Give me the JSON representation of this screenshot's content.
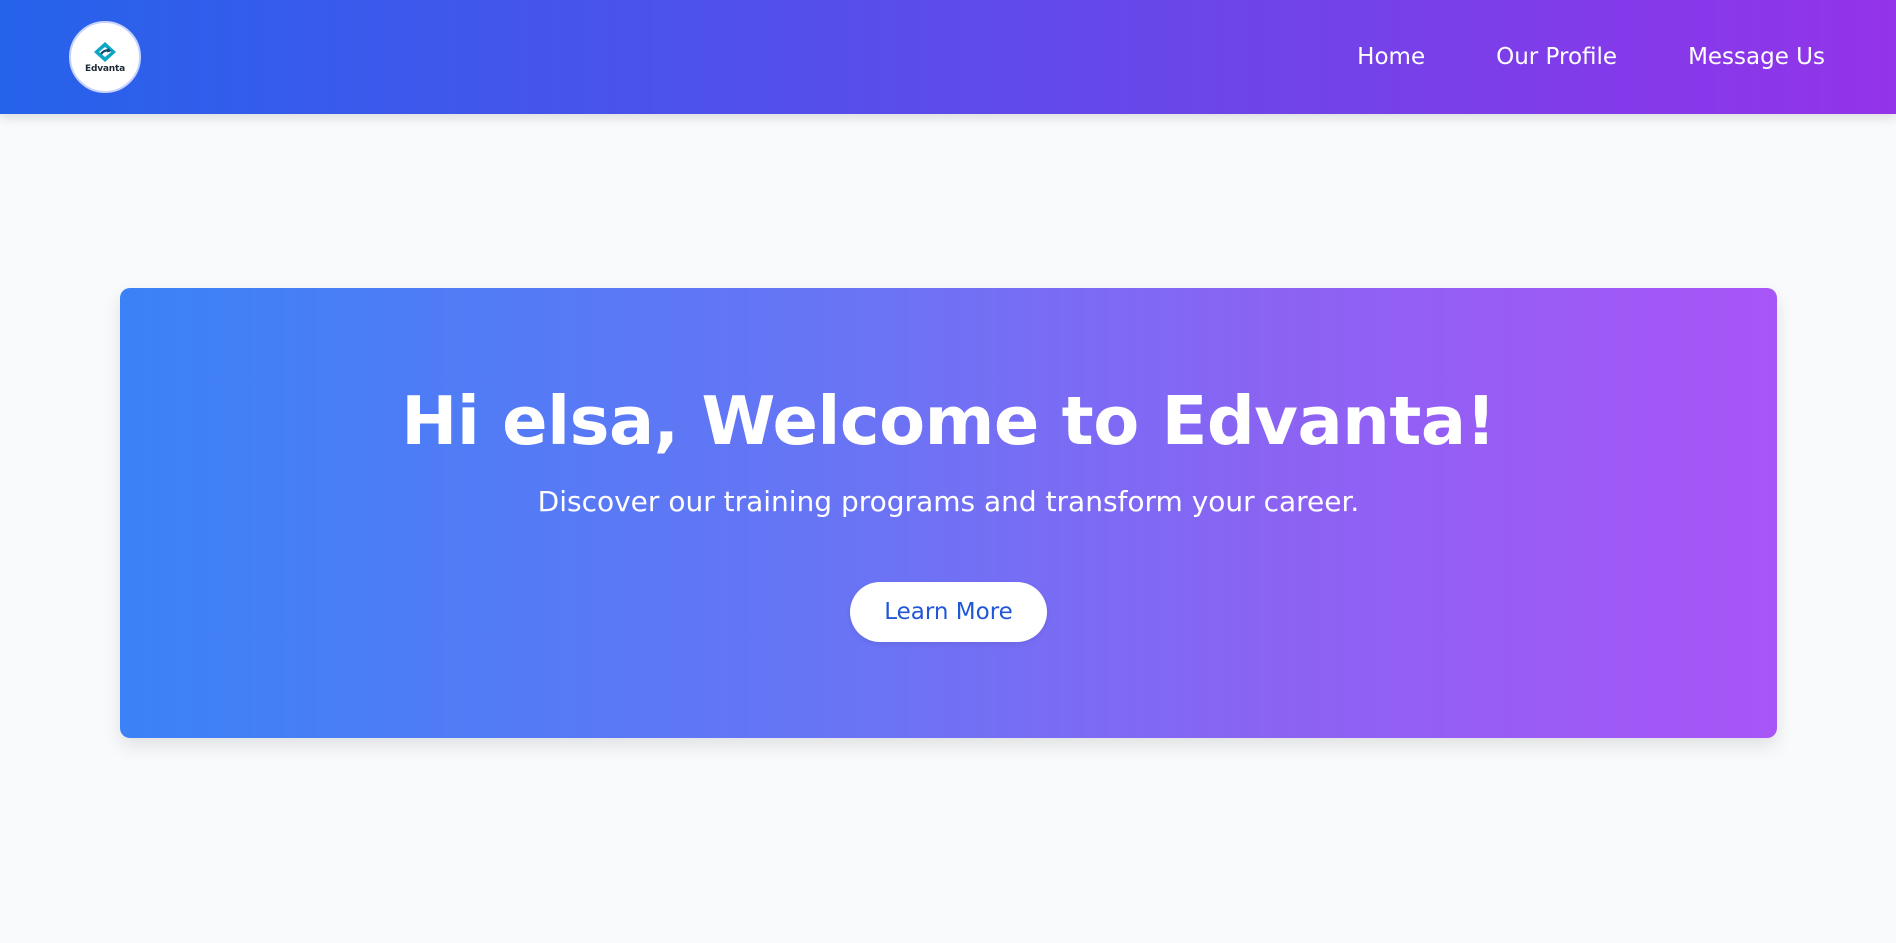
{
  "brand": {
    "logo_text": "Edvanta",
    "logo_icon": "edvanta-logo-icon"
  },
  "nav": {
    "items": [
      {
        "label": "Home"
      },
      {
        "label": "Our Profile"
      },
      {
        "label": "Message Us"
      }
    ]
  },
  "hero": {
    "title": "Hi elsa, Welcome to Edvanta!",
    "subtitle": "Discover our training programs and transform your career.",
    "cta_label": "Learn More"
  },
  "colors": {
    "nav_gradient_start": "#2563eb",
    "nav_gradient_end": "#9333ea",
    "hero_gradient_start": "#3b82f6",
    "hero_gradient_end": "#a855f7",
    "cta_text": "#2157d6",
    "page_background": "#f8fafc"
  }
}
